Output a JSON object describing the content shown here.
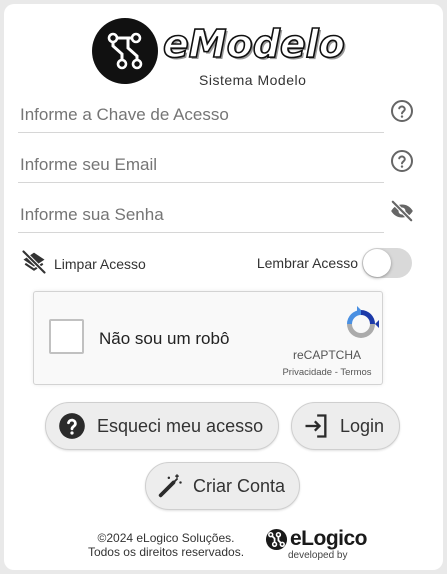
{
  "brand": {
    "name": "eModelo",
    "subtitle": "Sistema Modelo"
  },
  "fields": {
    "access_key": {
      "placeholder": "Informe a Chave de Acesso",
      "value": ""
    },
    "email": {
      "placeholder": "Informe seu Email",
      "value": ""
    },
    "password": {
      "placeholder": "Informe sua Senha",
      "value": ""
    }
  },
  "icons": {
    "access_key_help": "help-circle-icon",
    "email_help": "help-circle-icon",
    "password_visibility": "eye-off-icon",
    "clear_access": "layers-clear-icon",
    "forgot": "question-circle-icon",
    "login": "login-arrow-icon",
    "create": "magic-wand-icon"
  },
  "actions": {
    "clear_access_label": "Limpar Acesso",
    "remember_label": "Lembrar Acesso",
    "remember_on": false
  },
  "captcha": {
    "label": "Não sou um robô",
    "brand": "reCAPTCHA",
    "privacy": "Privacidade",
    "separator": "-",
    "terms": "Termos"
  },
  "buttons": {
    "forgot": "Esqueci meu acesso",
    "login": "Login",
    "create": "Criar Conta"
  },
  "footer": {
    "copyright_line1": "©2024 eLogico Soluções.",
    "copyright_line2": "Todos os direitos reservados.",
    "developer_name": "eLogico",
    "developer_caption": "developed by"
  },
  "colors": {
    "background": "#e9e9e9",
    "card": "#ffffff",
    "button_bg": "#ededed",
    "toggle_off": "#d9d9d9",
    "recaptcha_blue": "#1c3aa9",
    "recaptcha_light": "#4a90e2",
    "recaptcha_gray": "#ababab"
  }
}
